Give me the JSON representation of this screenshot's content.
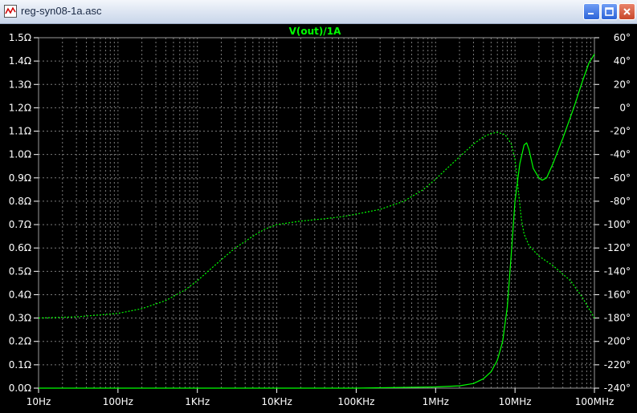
{
  "window": {
    "title": "reg-syn08-1a.asc",
    "buttons": {
      "minimize": "minimize-icon",
      "maximize": "maximize-icon",
      "close": "close-icon"
    }
  },
  "colors": {
    "background": "#000000",
    "trace": "#00ff00",
    "grid": "#7a7a7a",
    "axis_text": "#ffffff",
    "title_text": "#00ff00"
  },
  "chart_data": {
    "type": "line",
    "title": "V(out)/1A",
    "x_scale": "log",
    "xlim": [
      10,
      100000000
    ],
    "x_ticks": [
      {
        "value": 10,
        "label": "10Hz"
      },
      {
        "value": 100,
        "label": "100Hz"
      },
      {
        "value": 1000,
        "label": "1KHz"
      },
      {
        "value": 10000,
        "label": "10KHz"
      },
      {
        "value": 100000,
        "label": "100KHz"
      },
      {
        "value": 1000000,
        "label": "1MHz"
      },
      {
        "value": 10000000,
        "label": "10MHz"
      },
      {
        "value": 100000000,
        "label": "100MHz"
      }
    ],
    "left_axis": {
      "unit": "Ω",
      "ylim": [
        0.0,
        1.5
      ],
      "tick_labels": [
        "1.5Ω",
        "1.4Ω",
        "1.3Ω",
        "1.2Ω",
        "1.1Ω",
        "1.0Ω",
        "0.9Ω",
        "0.8Ω",
        "0.7Ω",
        "0.6Ω",
        "0.5Ω",
        "0.4Ω",
        "0.3Ω",
        "0.2Ω",
        "0.1Ω",
        "0.0Ω"
      ]
    },
    "right_axis": {
      "unit": "°",
      "ylim": [
        -240,
        60
      ],
      "tick_labels": [
        "60°",
        "40°",
        "20°",
        "0°",
        "-20°",
        "-40°",
        "-60°",
        "-80°",
        "-100°",
        "-120°",
        "-140°",
        "-160°",
        "-180°",
        "-200°",
        "-220°",
        "-240°"
      ]
    },
    "grid": true,
    "series": [
      {
        "style": "solid",
        "axis": "left",
        "points": [
          [
            10,
            0.0
          ],
          [
            100000,
            0.0
          ],
          [
            1000000,
            0.005
          ],
          [
            2000000,
            0.01
          ],
          [
            3000000,
            0.02
          ],
          [
            4000000,
            0.04
          ],
          [
            5000000,
            0.07
          ],
          [
            6000000,
            0.12
          ],
          [
            7000000,
            0.2
          ],
          [
            8000000,
            0.35
          ],
          [
            9000000,
            0.58
          ],
          [
            10000000,
            0.8
          ],
          [
            11500000,
            0.96
          ],
          [
            13000000,
            1.04
          ],
          [
            14000000,
            1.05
          ],
          [
            15000000,
            1.02
          ],
          [
            17000000,
            0.94
          ],
          [
            20000000,
            0.9
          ],
          [
            22000000,
            0.89
          ],
          [
            25000000,
            0.9
          ],
          [
            30000000,
            0.96
          ],
          [
            40000000,
            1.07
          ],
          [
            55000000,
            1.2
          ],
          [
            70000000,
            1.31
          ],
          [
            85000000,
            1.39
          ],
          [
            100000000,
            1.43
          ]
        ]
      },
      {
        "style": "dotted",
        "axis": "right",
        "points": [
          [
            10,
            -180
          ],
          [
            30,
            -179
          ],
          [
            100,
            -176
          ],
          [
            200,
            -172
          ],
          [
            400,
            -165
          ],
          [
            700,
            -156
          ],
          [
            1000,
            -148
          ],
          [
            2000,
            -130
          ],
          [
            3000,
            -120
          ],
          [
            5000,
            -110
          ],
          [
            7000,
            -104
          ],
          [
            10000,
            -100
          ],
          [
            20000,
            -97
          ],
          [
            40000,
            -95
          ],
          [
            70000,
            -93
          ],
          [
            100000,
            -91
          ],
          [
            200000,
            -87
          ],
          [
            400000,
            -80
          ],
          [
            700000,
            -70
          ],
          [
            1000000,
            -61
          ],
          [
            2000000,
            -42
          ],
          [
            3000000,
            -31
          ],
          [
            4000000,
            -25
          ],
          [
            5000000,
            -22
          ],
          [
            6000000,
            -21
          ],
          [
            7500000,
            -23
          ],
          [
            9000000,
            -31
          ],
          [
            10000000,
            -44
          ],
          [
            11000000,
            -70
          ],
          [
            12000000,
            -95
          ],
          [
            13000000,
            -108
          ],
          [
            15000000,
            -118
          ],
          [
            20000000,
            -127
          ],
          [
            30000000,
            -135
          ],
          [
            50000000,
            -148
          ],
          [
            70000000,
            -162
          ],
          [
            100000000,
            -180
          ]
        ]
      }
    ]
  }
}
